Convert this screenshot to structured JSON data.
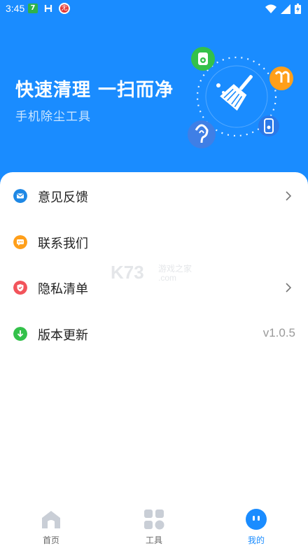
{
  "status_bar": {
    "time": "3:45",
    "badge_num": "7",
    "badge_text": "无"
  },
  "hero": {
    "title": "快速清理 一扫而净",
    "subtitle": "手机除尘工具"
  },
  "menu": [
    {
      "label": "意见反馈",
      "icon": "mail-icon",
      "color": "#1e88e5",
      "trailing": "chevron"
    },
    {
      "label": "联系我们",
      "icon": "chat-icon",
      "color": "#ff9f1a",
      "trailing": ""
    },
    {
      "label": "隐私清单",
      "icon": "shield-icon",
      "color": "#f2545b",
      "trailing": "chevron"
    },
    {
      "label": "版本更新",
      "icon": "download-icon",
      "color": "#33c14a",
      "trailing": "v1.0.5"
    }
  ],
  "watermark": {
    "logo": "K73",
    "site": "游戏之家",
    "domain": ".com"
  },
  "tabbar": {
    "tabs": [
      {
        "label": "首页",
        "icon": "home-icon",
        "active": false
      },
      {
        "label": "工具",
        "icon": "grid-icon",
        "active": false
      },
      {
        "label": "我的",
        "icon": "profile-face-icon",
        "active": true
      }
    ]
  },
  "colors": {
    "primary": "#1a8cff",
    "text": "#222222",
    "muted": "#9a9a9a"
  }
}
